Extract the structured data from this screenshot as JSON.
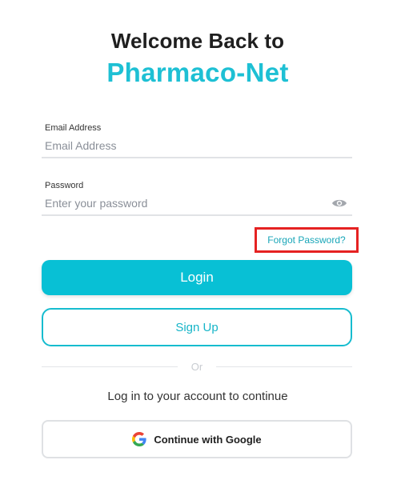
{
  "header": {
    "welcome_text": "Welcome Back to",
    "brand_name": "Pharmaco-Net"
  },
  "form": {
    "email": {
      "label": "Email Address",
      "placeholder": "Email Address",
      "value": ""
    },
    "password": {
      "label": "Password",
      "placeholder": "Enter your password",
      "value": "",
      "toggle_icon": "eye-icon"
    },
    "forgot_password_label": "Forgot Password?",
    "login_label": "Login",
    "signup_label": "Sign Up"
  },
  "divider": {
    "text": "Or"
  },
  "social": {
    "subtitle": "Log in to your account to continue",
    "google_label": "Continue with Google",
    "google_icon": "google-icon"
  },
  "colors": {
    "brand": "#1ec0d4",
    "primary_button": "#08c0d5",
    "highlight_border": "#e52222"
  }
}
